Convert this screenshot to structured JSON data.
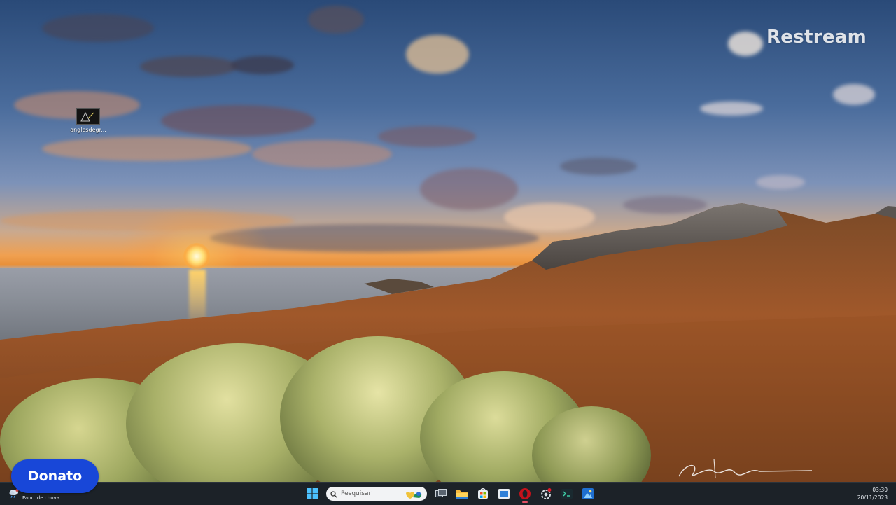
{
  "overlay": {
    "watermark": "Restream",
    "donate_label": "Donato"
  },
  "desktop": {
    "icons": [
      {
        "label": "anglesdegr...",
        "icon": "image-file-icon"
      }
    ]
  },
  "taskbar": {
    "weather_label": "Panc. de chuva",
    "search_placeholder": "Pesquisar",
    "clock": {
      "time": "03:30",
      "date": "20/11/2023"
    },
    "pinned": [
      "windows-start-icon",
      "task-view-icon",
      "file-explorer-icon",
      "store-icon",
      "app-window-icon",
      "opera-browser-icon",
      "settings-icon",
      "terminal-app-icon",
      "photos-app-icon"
    ]
  },
  "colors": {
    "donate_bg": "#1847d8",
    "taskbar_bg": "#1c2228",
    "notification_red": "#e21b2a"
  }
}
